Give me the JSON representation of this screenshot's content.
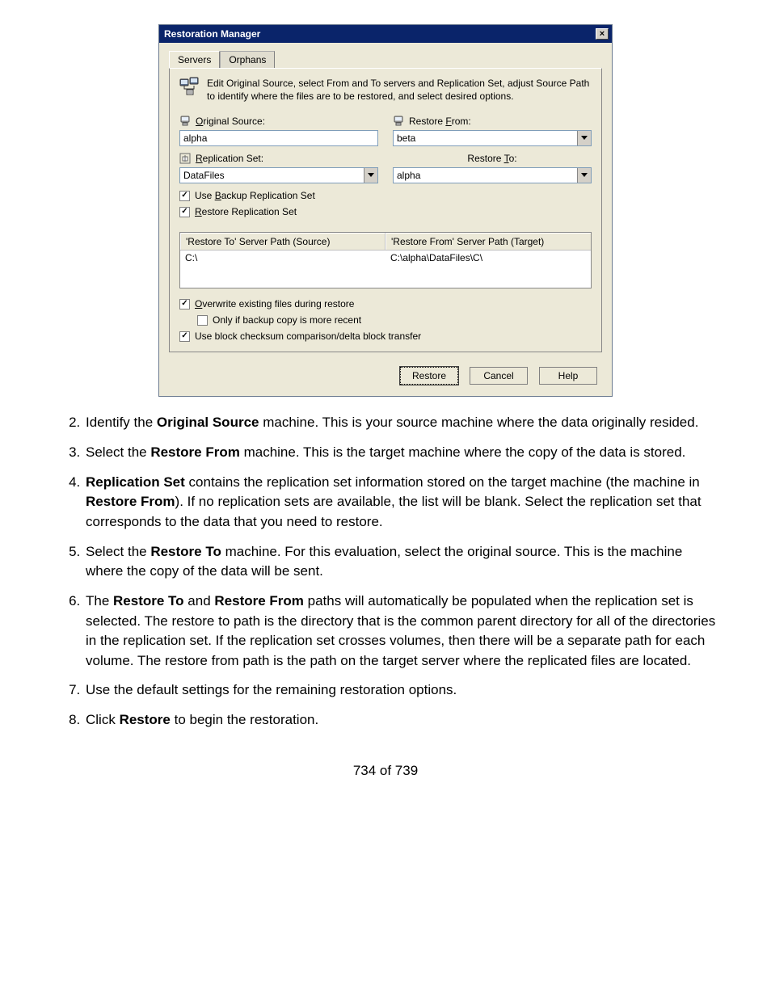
{
  "dialog": {
    "title": "Restoration Manager",
    "close_label": "×",
    "tabs": {
      "servers": "Servers",
      "orphans": "Orphans"
    },
    "intro": "Edit Original Source, select From and To servers and Replication Set, adjust Source Path to identify where the files are to be restored, and select desired options.",
    "labels": {
      "original_source_pre": "O",
      "original_source_post": "riginal Source:",
      "restore_from_pre": "Restore ",
      "restore_from_u": "F",
      "restore_from_post": "rom:",
      "replication_set_u": "R",
      "replication_set_post": "eplication Set:",
      "restore_to_pre": "Restore ",
      "restore_to_u": "T",
      "restore_to_post": "o:"
    },
    "fields": {
      "original_source": "alpha",
      "restore_from": "beta",
      "replication_set": "DataFiles",
      "restore_to": "alpha"
    },
    "checkboxes": {
      "use_backup_pre": "Use ",
      "use_backup_u": "B",
      "use_backup_post": "ackup Replication Set",
      "restore_repset_u": "R",
      "restore_repset_post": "estore Replication Set",
      "overwrite_u": "O",
      "overwrite_post": "verwrite existing files during restore",
      "only_if_recent": "Only if backup copy is more recent",
      "use_block": "Use block checksum comparison/delta block transfer"
    },
    "paths": {
      "header_source": "'Restore To' Server Path (Source)",
      "header_target": "'Restore From' Server Path (Target)",
      "row_source": "C:\\",
      "row_target": "C:\\alpha\\DataFiles\\C\\"
    },
    "buttons": {
      "restore": "Restore",
      "cancel": "Cancel",
      "help": "Help"
    }
  },
  "steps": {
    "s2a": "Identify the ",
    "s2b": "Original Source",
    "s2c": " machine. This is your source machine where the data originally resided.",
    "s3a": "Select the ",
    "s3b": "Restore From",
    "s3c": " machine. This is the target machine where the copy of the data is stored.",
    "s4a": "Replication Set",
    "s4b": " contains the replication set information stored on the target machine (the machine in ",
    "s4c": "Restore From",
    "s4d": "). If no replication sets are available, the list will be blank. Select the replication set that corresponds to the data that you need to restore.",
    "s5a": "Select the ",
    "s5b": "Restore To",
    "s5c": " machine. For this evaluation, select the original source. This is the machine where the copy of the data will be sent.",
    "s6a": "The ",
    "s6b": "Restore To",
    "s6c": " and ",
    "s6d": "Restore From",
    "s6e": " paths will automatically be populated when the replication set is selected. The restore to path is the directory that is the common parent directory for all of the directories in the replication set. If the replication set crosses volumes, then there will be a separate path for each volume. The restore from path is the path on the target server where the replicated files are located.",
    "s7": "Use the default settings for the remaining restoration options.",
    "s8a": "Click ",
    "s8b": "Restore",
    "s8c": " to begin the restoration."
  },
  "page_number": "734 of 739"
}
